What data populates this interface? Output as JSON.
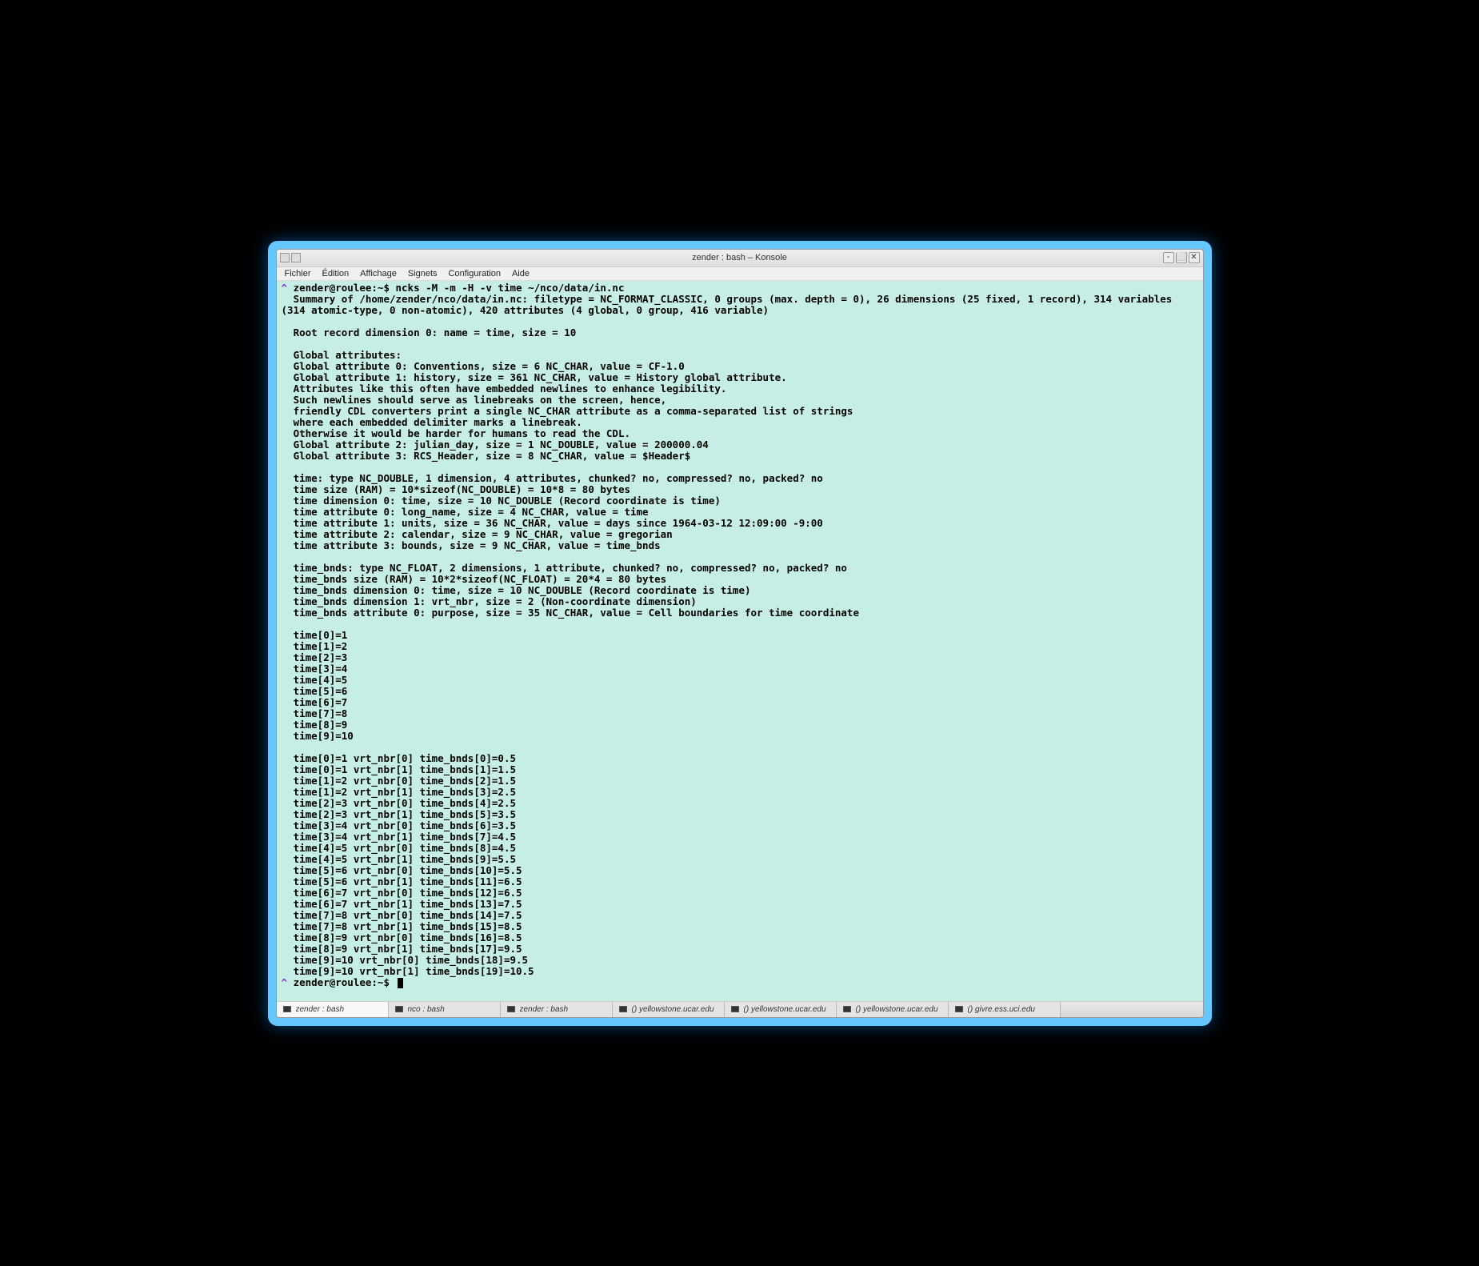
{
  "window": {
    "title": "zender : bash – Konsole"
  },
  "menu": {
    "items": [
      "Fichier",
      "Édition",
      "Affichage",
      "Signets",
      "Configuration",
      "Aide"
    ]
  },
  "prompt": {
    "caret": "^",
    "host": "zender@roulee:~$ ",
    "command": "ncks -M -m -H -v time ~/nco/data/in.nc"
  },
  "output_lines": [
    "Summary of /home/zender/nco/data/in.nc: filetype = NC_FORMAT_CLASSIC, 0 groups (max. depth = 0), 26 dimensions (25 fixed, 1 record), 314 variables (314 atomic-type, 0 non-atomic), 420 attributes (4 global, 0 group, 416 variable)",
    "",
    "Root record dimension 0: name = time, size = 10",
    "",
    "Global attributes:",
    "Global attribute 0: Conventions, size = 6 NC_CHAR, value = CF-1.0",
    "Global attribute 1: history, size = 361 NC_CHAR, value = History global attribute.",
    "Attributes like this often have embedded newlines to enhance legibility.",
    "Such newlines should serve as linebreaks on the screen, hence,",
    "friendly CDL converters print a single NC_CHAR attribute as a comma-separated list of strings",
    "where each embedded delimiter marks a linebreak.",
    "Otherwise it would be harder for humans to read the CDL.",
    "Global attribute 2: julian_day, size = 1 NC_DOUBLE, value = 200000.04",
    "Global attribute 3: RCS_Header, size = 8 NC_CHAR, value = $Header$",
    "",
    "time: type NC_DOUBLE, 1 dimension, 4 attributes, chunked? no, compressed? no, packed? no",
    "time size (RAM) = 10*sizeof(NC_DOUBLE) = 10*8 = 80 bytes",
    "time dimension 0: time, size = 10 NC_DOUBLE (Record coordinate is time)",
    "time attribute 0: long_name, size = 4 NC_CHAR, value = time",
    "time attribute 1: units, size = 36 NC_CHAR, value = days since 1964-03-12 12:09:00 -9:00",
    "time attribute 2: calendar, size = 9 NC_CHAR, value = gregorian",
    "time attribute 3: bounds, size = 9 NC_CHAR, value = time_bnds",
    "",
    "time_bnds: type NC_FLOAT, 2 dimensions, 1 attribute, chunked? no, compressed? no, packed? no",
    "time_bnds size (RAM) = 10*2*sizeof(NC_FLOAT) = 20*4 = 80 bytes",
    "time_bnds dimension 0: time, size = 10 NC_DOUBLE (Record coordinate is time)",
    "time_bnds dimension 1: vrt_nbr, size = 2 (Non-coordinate dimension)",
    "time_bnds attribute 0: purpose, size = 35 NC_CHAR, value = Cell boundaries for time coordinate",
    "",
    "time[0]=1",
    "time[1]=2",
    "time[2]=3",
    "time[3]=4",
    "time[4]=5",
    "time[5]=6",
    "time[6]=7",
    "time[7]=8",
    "time[8]=9",
    "time[9]=10",
    "",
    "time[0]=1 vrt_nbr[0] time_bnds[0]=0.5",
    "time[0]=1 vrt_nbr[1] time_bnds[1]=1.5",
    "time[1]=2 vrt_nbr[0] time_bnds[2]=1.5",
    "time[1]=2 vrt_nbr[1] time_bnds[3]=2.5",
    "time[2]=3 vrt_nbr[0] time_bnds[4]=2.5",
    "time[2]=3 vrt_nbr[1] time_bnds[5]=3.5",
    "time[3]=4 vrt_nbr[0] time_bnds[6]=3.5",
    "time[3]=4 vrt_nbr[1] time_bnds[7]=4.5",
    "time[4]=5 vrt_nbr[0] time_bnds[8]=4.5",
    "time[4]=5 vrt_nbr[1] time_bnds[9]=5.5",
    "time[5]=6 vrt_nbr[0] time_bnds[10]=5.5",
    "time[5]=6 vrt_nbr[1] time_bnds[11]=6.5",
    "time[6]=7 vrt_nbr[0] time_bnds[12]=6.5",
    "time[6]=7 vrt_nbr[1] time_bnds[13]=7.5",
    "time[7]=8 vrt_nbr[0] time_bnds[14]=7.5",
    "time[7]=8 vrt_nbr[1] time_bnds[15]=8.5",
    "time[8]=9 vrt_nbr[0] time_bnds[16]=8.5",
    "time[8]=9 vrt_nbr[1] time_bnds[17]=9.5",
    "time[9]=10 vrt_nbr[0] time_bnds[18]=9.5",
    "time[9]=10 vrt_nbr[1] time_bnds[19]=10.5"
  ],
  "tabs": [
    {
      "label": "zender : bash",
      "active": true
    },
    {
      "label": "nco : bash",
      "active": false
    },
    {
      "label": "zender : bash",
      "active": false
    },
    {
      "label": "() yellowstone.ucar.edu",
      "active": false
    },
    {
      "label": "() yellowstone.ucar.edu",
      "active": false
    },
    {
      "label": "() yellowstone.ucar.edu",
      "active": false
    },
    {
      "label": "() givre.ess.uci.edu",
      "active": false
    }
  ]
}
